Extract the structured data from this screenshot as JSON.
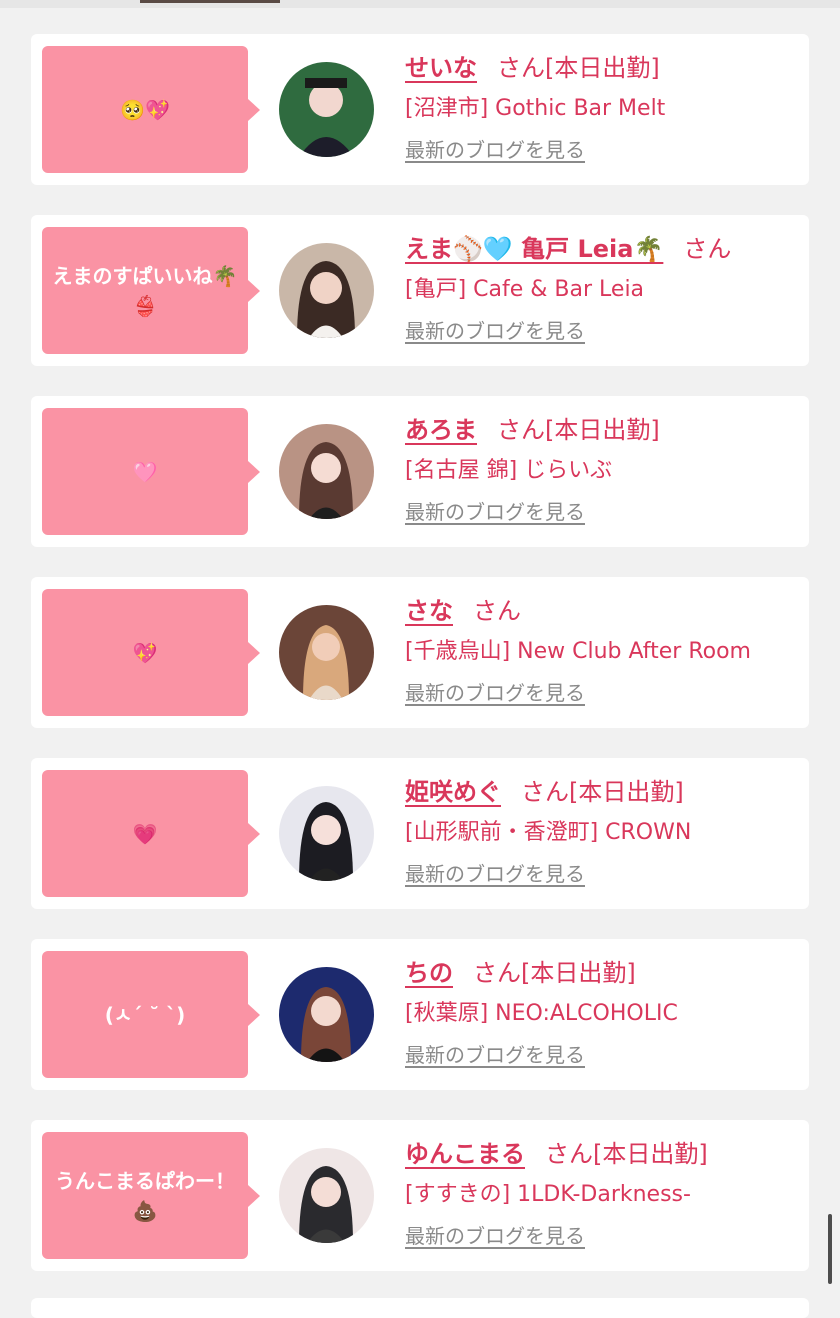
{
  "cards": [
    {
      "message": "🥺💖",
      "name": "せいな",
      "suffix": "さん[本日出勤]",
      "shop": "[沼津市] Gothic Bar Melt",
      "blog_link": "最新のブログを見る",
      "avatar_color": "#2f6b3f"
    },
    {
      "message": "えまのすぱいいね🌴👙",
      "name": "えま⚾️🩵 亀戸 Leia🌴",
      "suffix": "さん",
      "shop": "[亀戸] Cafe & Bar Leia",
      "blog_link": "最新のブログを見る",
      "avatar_color": "#5a4036"
    },
    {
      "message": "🩷",
      "name": "あろま",
      "suffix": "さん[本日出勤]",
      "shop": "[名古屋 錦] じらいぶ",
      "blog_link": "最新のブログを見る",
      "avatar_color": "#6d4a3f"
    },
    {
      "message": "💖",
      "name": "さな",
      "suffix": "さん",
      "shop": "[千歳烏山] New Club After Room",
      "blog_link": "最新のブログを見る",
      "avatar_color": "#7a4b3d"
    },
    {
      "message": "💗",
      "name": "姫咲めぐ",
      "suffix": "さん[本日出勤]",
      "shop": "[山形駅前・香澄町] CROWN",
      "blog_link": "最新のブログを見る",
      "avatar_color": "#d9d9e3"
    },
    {
      "message": "(ㅅ´ ˘ `)",
      "name": "ちの",
      "suffix": "さん[本日出勤]",
      "shop": "[秋葉原] NEO:ALCOHOLIC",
      "blog_link": "最新のブログを見る",
      "avatar_color": "#1d2a6e"
    },
    {
      "message": "うんこまるぱわー！💩",
      "name": "ゆんこまる",
      "suffix": "さん[本日出勤]",
      "shop": "[すすきの] 1LDK-Darkness-",
      "blog_link": "最新のブログを見る",
      "avatar_color": "#3a3a3a"
    }
  ],
  "colors": {
    "accent": "#d9375b",
    "bubble": "#fa93a4",
    "link_gray": "#8a8a8a",
    "background": "#f1f1f1"
  }
}
